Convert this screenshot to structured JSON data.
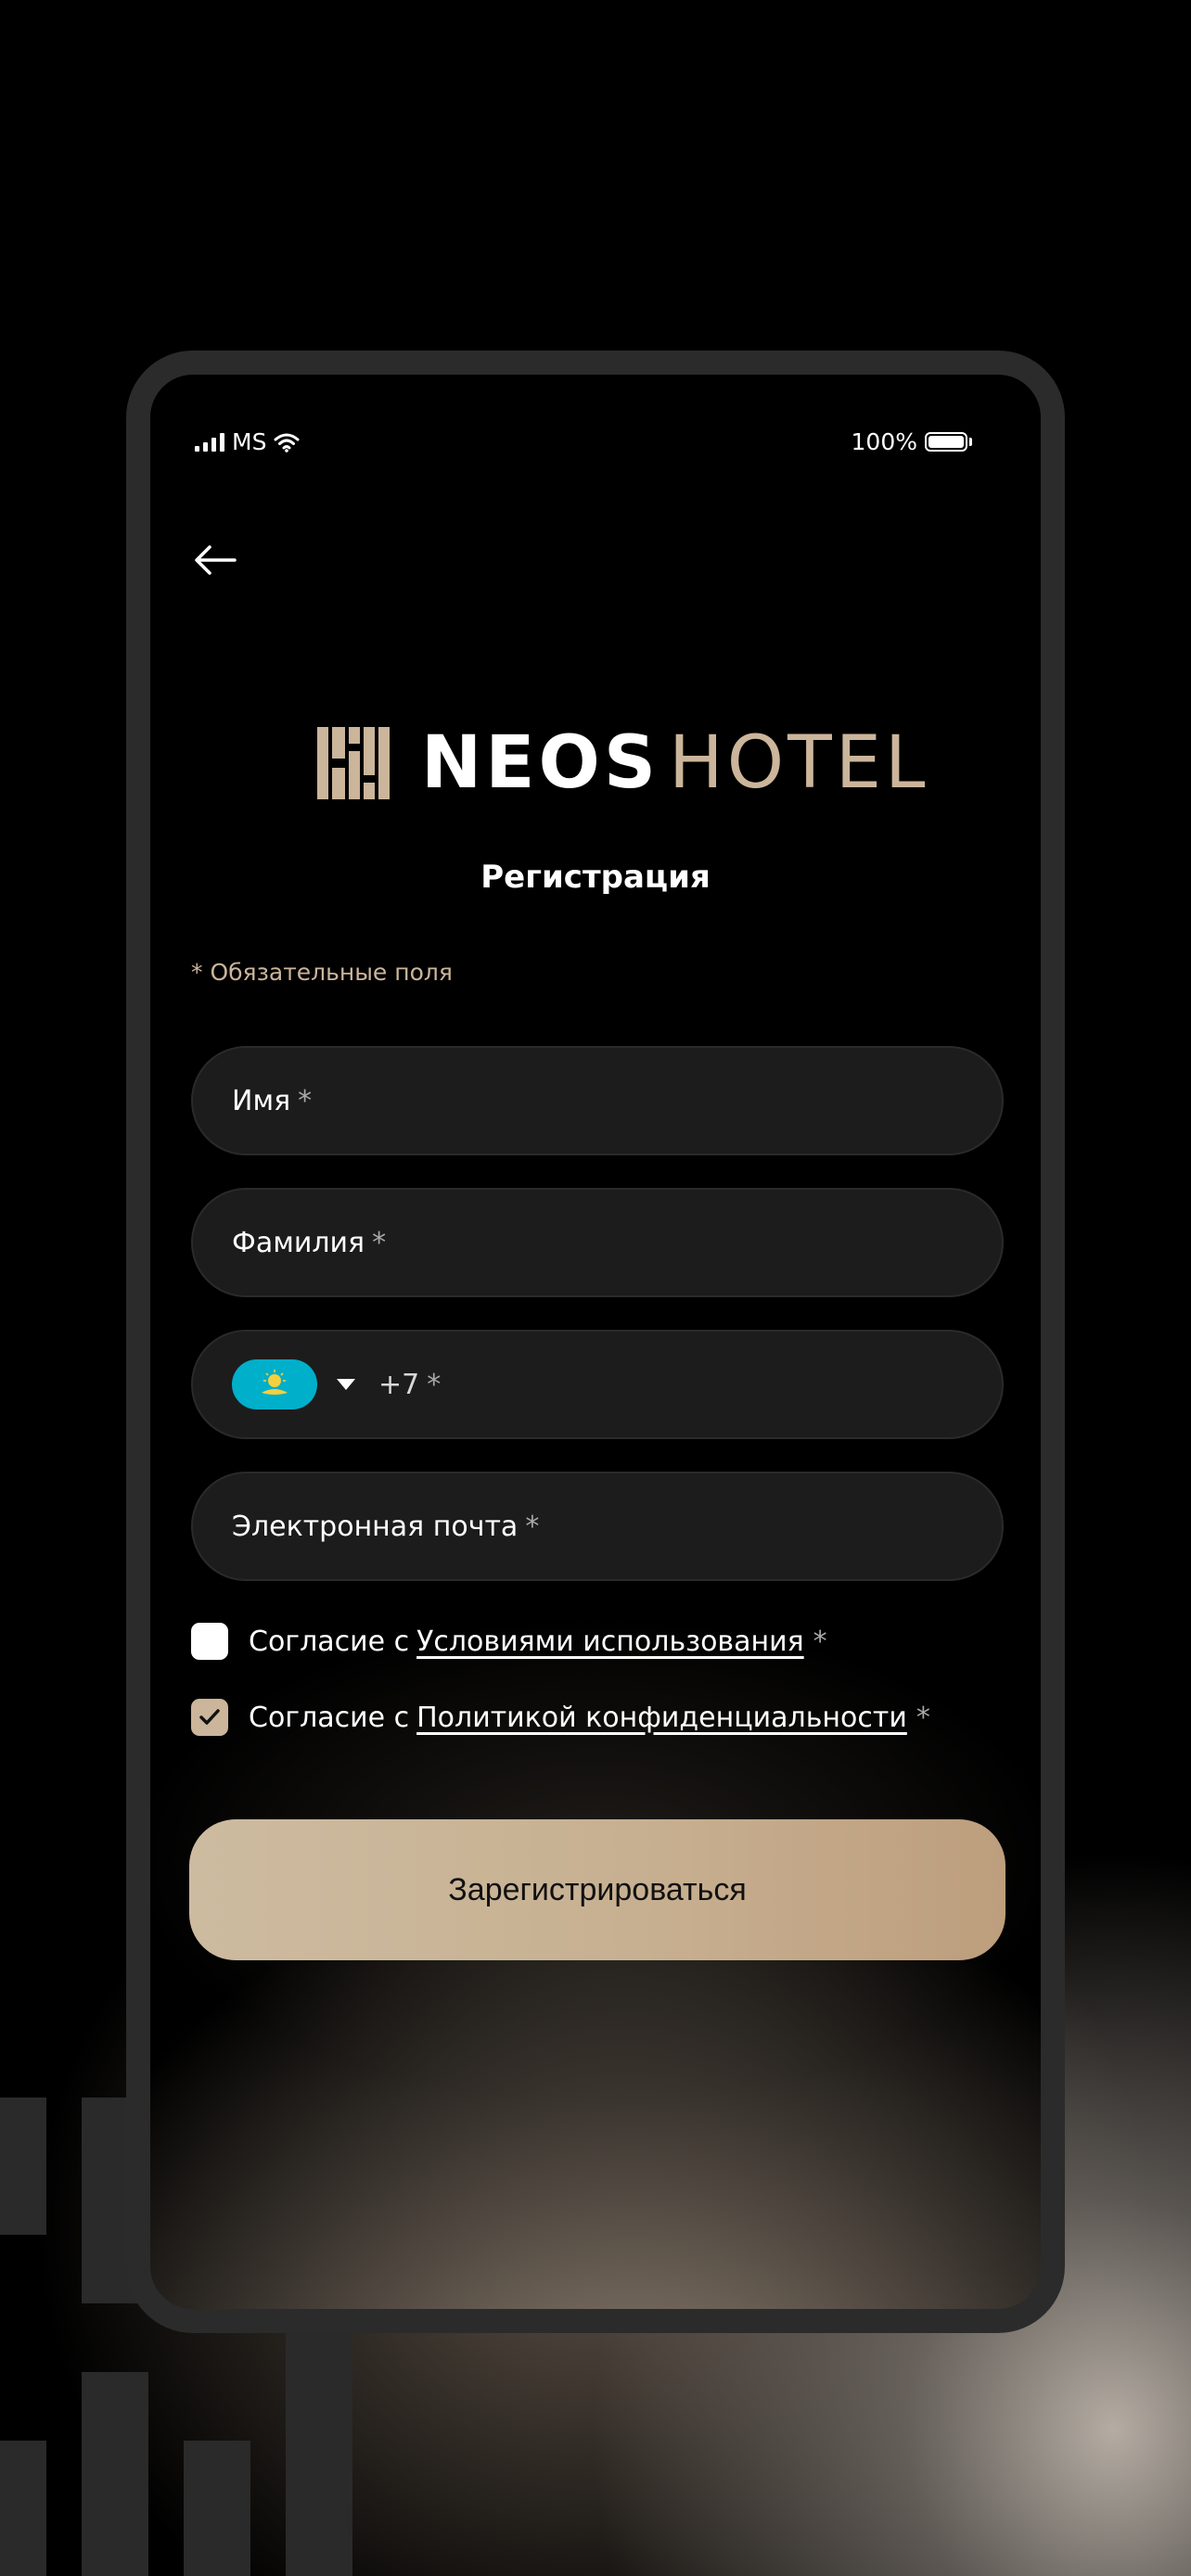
{
  "status_bar": {
    "carrier": "MS",
    "battery": "100%"
  },
  "logo": {
    "word_bold": "NEOS",
    "word_light": "HOTEL"
  },
  "page_title": "Регистрация",
  "required_note": "* Обязательные поля",
  "fields": {
    "first_name": {
      "label": "Имя",
      "required_mark": "*"
    },
    "last_name": {
      "label": "Фамилия",
      "required_mark": "*"
    },
    "phone": {
      "prefix": "+7",
      "required_mark": "*",
      "country_flag": "kazakhstan-flag"
    },
    "email": {
      "label": "Электронная почта",
      "required_mark": "*"
    }
  },
  "consents": [
    {
      "prefix": "Согласие с",
      "link": "Условиями использования",
      "required_mark": "*",
      "checked": false
    },
    {
      "prefix": "Согласие с",
      "link": "Политикой конфиденциальности",
      "required_mark": "*",
      "checked": true
    }
  ],
  "register_button": "Зарегистрироваться",
  "colors": {
    "accent": "#cbb59b",
    "field_bg": "#1c1c1c",
    "background": "#000000",
    "flag_blue": "#00afca",
    "flag_gold": "#f4d03f"
  },
  "icons": [
    "signal-icon",
    "wifi-icon",
    "battery-icon",
    "back-arrow-icon",
    "logo-mark-icon",
    "kazakhstan-flag-icon",
    "chevron-down-icon",
    "checkmark-icon"
  ]
}
